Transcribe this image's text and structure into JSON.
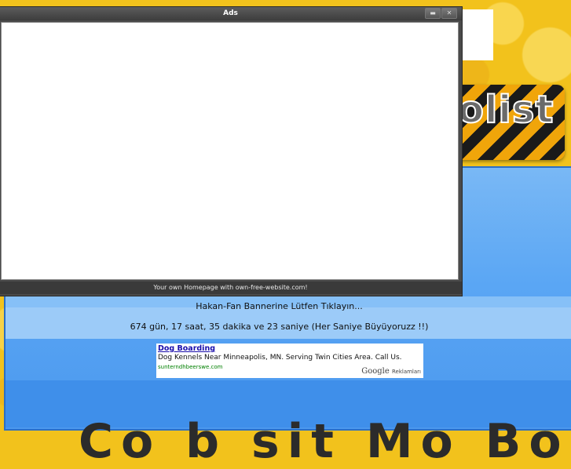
{
  "ads_window": {
    "title": "Ads",
    "footer_text": "Your own Homepage with own-free-website.com!",
    "buttons": {
      "minimize": "▬",
      "close": "✕"
    }
  },
  "banner": {
    "logo_text": "olist"
  },
  "page": {
    "banner_click_text": "Hakan-Fan Bannerine Lütfen Tıklayın...",
    "counter_text": "674 gün, 17 saat, 35 dakika ve 23 saniye (Her Saniye Büyüyoruzz !!)",
    "bottom_text": "Co  b  sit Mo  Bo"
  },
  "ad": {
    "title": "Dog Boarding",
    "description": "Dog Kennels Near Minneapolis, MN. Serving Twin Cities Area. Call Us.",
    "url": "sunterndhbeerswe.com",
    "brand": "Google",
    "brand_suffix": "Reklamları"
  },
  "colors": {
    "background": "#f2c21c",
    "panel_blue": "#5aa6f4",
    "window_dark": "#4a4a4a",
    "ad_link": "#1a0dab"
  }
}
